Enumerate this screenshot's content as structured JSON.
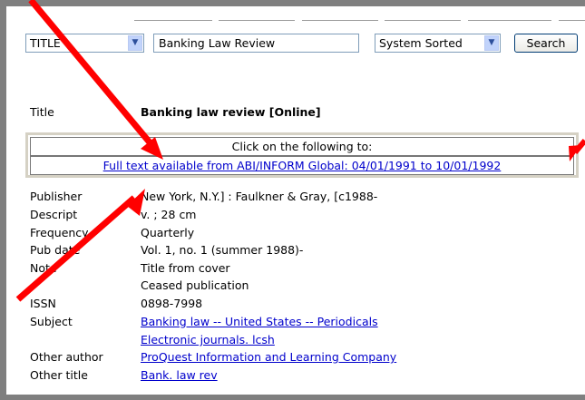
{
  "search": {
    "field_select": "TITLE",
    "query": "Banking Law Review",
    "sort_select": "System Sorted",
    "search_button": "Search"
  },
  "record": {
    "title_label": "Title",
    "title_value": "Banking law review [Online]",
    "links_header": "Click on the following to:",
    "fulltext_link": "Full text available from ABI/INFORM Global: 04/01/1991 to 10/01/1992",
    "fields": [
      {
        "label": "Publisher",
        "value": "New York, N.Y.] : Faulkner & Gray, [c1988-"
      },
      {
        "label": "Descript",
        "value": "v. ; 28 cm"
      },
      {
        "label": "Frequency",
        "value": "Quarterly"
      },
      {
        "label": "Pub date",
        "value": "Vol. 1, no. 1 (summer 1988)-"
      },
      {
        "label": "Note",
        "value": "Title from cover"
      },
      {
        "label": "",
        "value": "Ceased publication"
      },
      {
        "label": "ISSN",
        "value": "0898-7998"
      }
    ],
    "subject_label": "Subject",
    "subjects": [
      "Banking law -- United States -- Periodicals",
      "Electronic journals. lcsh"
    ],
    "other_author_label": "Other author",
    "other_author": "ProQuest Information and Learning Company",
    "other_title_label": "Other title",
    "other_title": "Bank. law rev"
  },
  "icons": {
    "dropdown": "chevron-down-icon",
    "annotation": "red-arrow"
  },
  "colors": {
    "link": "#0000cc",
    "annotation_arrow": "#ff0000",
    "frame": "#7f7f7f"
  }
}
